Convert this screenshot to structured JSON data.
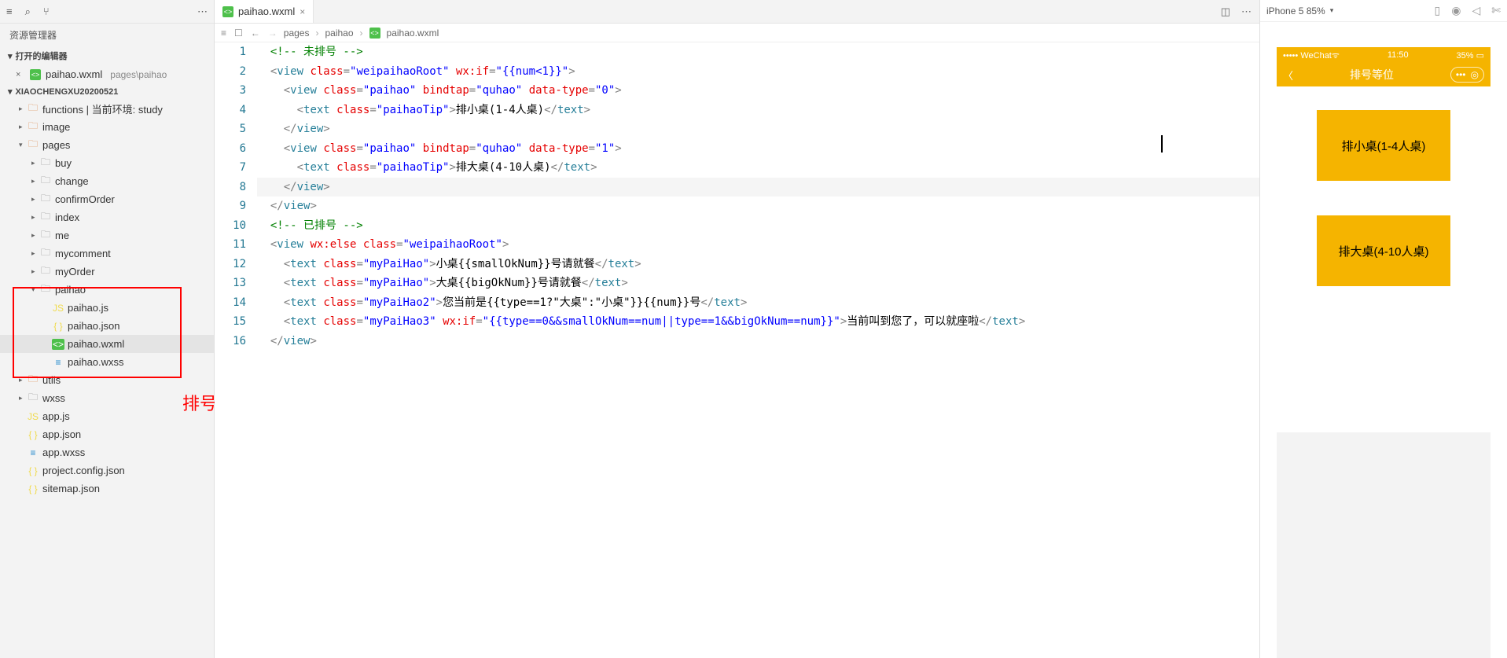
{
  "sidebar": {
    "title": "资源管理器",
    "openEditorsHeader": "打开的编辑器",
    "openEditor": {
      "name": "paihao.wxml",
      "path": "pages\\paihao"
    },
    "projectName": "XIAOCHENGXU20200521",
    "tree": [
      {
        "label": "functions | 当前环境: study",
        "indent": 1,
        "twist": "▸",
        "icon": "folder-color"
      },
      {
        "label": "image",
        "indent": 1,
        "twist": "▸",
        "icon": "folder-color"
      },
      {
        "label": "pages",
        "indent": 1,
        "twist": "▾",
        "icon": "folder-color"
      },
      {
        "label": "buy",
        "indent": 2,
        "twist": "▸",
        "icon": "folder"
      },
      {
        "label": "change",
        "indent": 2,
        "twist": "▸",
        "icon": "folder"
      },
      {
        "label": "confirmOrder",
        "indent": 2,
        "twist": "▸",
        "icon": "folder"
      },
      {
        "label": "index",
        "indent": 2,
        "twist": "▸",
        "icon": "folder"
      },
      {
        "label": "me",
        "indent": 2,
        "twist": "▸",
        "icon": "folder"
      },
      {
        "label": "mycomment",
        "indent": 2,
        "twist": "▸",
        "icon": "folder"
      },
      {
        "label": "myOrder",
        "indent": 2,
        "twist": "▸",
        "icon": "folder"
      },
      {
        "label": "paihao",
        "indent": 2,
        "twist": "▾",
        "icon": "folder"
      },
      {
        "label": "paihao.js",
        "indent": 3,
        "twist": "",
        "icon": "js"
      },
      {
        "label": "paihao.json",
        "indent": 3,
        "twist": "",
        "icon": "json"
      },
      {
        "label": "paihao.wxml",
        "indent": 3,
        "twist": "",
        "icon": "wxml",
        "sel": true
      },
      {
        "label": "paihao.wxss",
        "indent": 3,
        "twist": "",
        "icon": "wxss"
      },
      {
        "label": "utils",
        "indent": 1,
        "twist": "▸",
        "icon": "folder-color"
      },
      {
        "label": "wxss",
        "indent": 1,
        "twist": "▸",
        "icon": "folder"
      },
      {
        "label": "app.js",
        "indent": 1,
        "twist": "",
        "icon": "js"
      },
      {
        "label": "app.json",
        "indent": 1,
        "twist": "",
        "icon": "json"
      },
      {
        "label": "app.wxss",
        "indent": 1,
        "twist": "",
        "icon": "wxss"
      },
      {
        "label": "project.config.json",
        "indent": 1,
        "twist": "",
        "icon": "json"
      },
      {
        "label": "sitemap.json",
        "indent": 1,
        "twist": "",
        "icon": "json"
      }
    ]
  },
  "annotation": "排号相关代码",
  "tab": {
    "name": "paihao.wxml"
  },
  "breadcrumb": [
    "pages",
    "paihao",
    "paihao.wxml"
  ],
  "lineNumbers": [
    "1",
    "2",
    "3",
    "4",
    "5",
    "6",
    "7",
    "8",
    "9",
    "10",
    "11",
    "12",
    "13",
    "14",
    "15",
    "16"
  ],
  "code": {
    "l1": {
      "c": "<!-- 未排号 -->"
    },
    "l2": {
      "t": "view",
      "a1n": "class",
      "a1v": "\"weipaihaoRoot\"",
      "a2n": "wx:if",
      "a2v": "\"{{num<1}}\""
    },
    "l3": {
      "t": "view",
      "a1n": "class",
      "a1v": "\"paihao\"",
      "a2n": "bindtap",
      "a2v": "\"quhao\"",
      "a3n": "data-type",
      "a3v": "\"0\""
    },
    "l4": {
      "t": "text",
      "a1n": "class",
      "a1v": "\"paihaoTip\"",
      "inner": "排小桌(1-4人桌)"
    },
    "l5": {
      "t": "view"
    },
    "l6": {
      "t": "view",
      "a1n": "class",
      "a1v": "\"paihao\"",
      "a2n": "bindtap",
      "a2v": "\"quhao\"",
      "a3n": "data-type",
      "a3v": "\"1\""
    },
    "l7": {
      "t": "text",
      "a1n": "class",
      "a1v": "\"paihaoTip\"",
      "inner": "排大桌(4-10人桌)"
    },
    "l8": {
      "t": "view"
    },
    "l9": {
      "t": "view"
    },
    "l10": {
      "c": "<!-- 已排号 -->"
    },
    "l11": {
      "t": "view",
      "a1n": "wx:else",
      "a2n": "class",
      "a2v": "\"weipaihaoRoot\""
    },
    "l12": {
      "t": "text",
      "a1n": "class",
      "a1v": "\"myPaiHao\"",
      "p1": "小桌",
      "v1": "{{smallOkNum}}",
      "p2": "号请就餐"
    },
    "l13": {
      "t": "text",
      "a1n": "class",
      "a1v": "\"myPaiHao\"",
      "p1": "大桌",
      "v1": "{{bigOkNum}}",
      "p2": "号请就餐"
    },
    "l14": {
      "t": "text",
      "a1n": "class",
      "a1v": "\"myPaiHao2\"",
      "p1": "您当前是",
      "v1": "{{type==1?\"大桌\":\"小桌\"}}{{num}}",
      "p2": "号"
    },
    "l15": {
      "t": "text",
      "a1n": "class",
      "a1v": "\"myPaiHao3\"",
      "a2n": "wx:if",
      "a2v": "\"{{type==0&&smallOkNum==num||type==1&&bigOkNum==num}}\"",
      "inner": "当前叫到您了，可以就座啦"
    },
    "l16": {
      "t": "view"
    }
  },
  "preview": {
    "device": "iPhone 5 85%",
    "carrier": "WeChat",
    "time": "11:50",
    "battery": "35%",
    "navTitle": "排号等位",
    "card1": "排小桌(1-4人桌)",
    "card2": "排大桌(4-10人桌)"
  }
}
